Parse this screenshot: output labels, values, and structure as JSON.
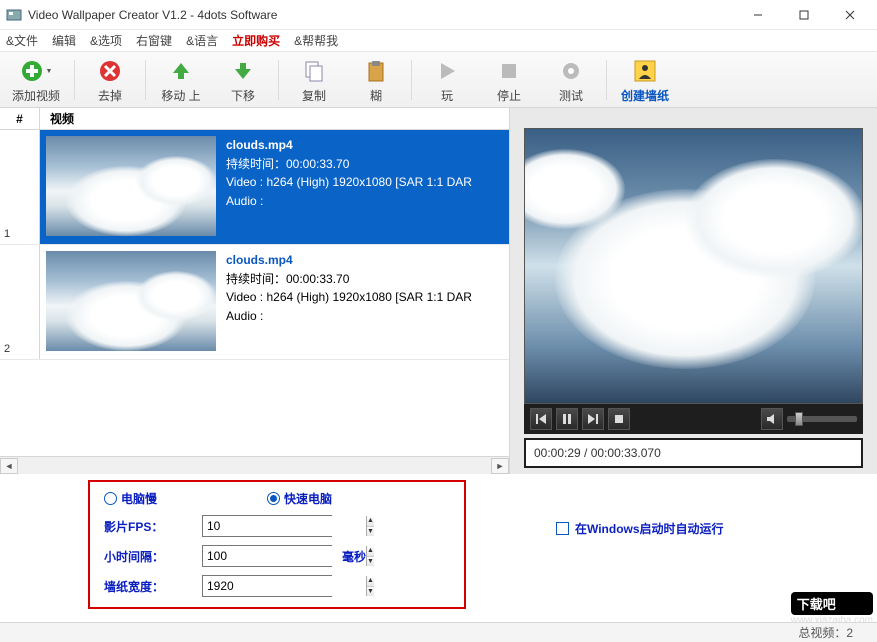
{
  "window": {
    "title": "Video Wallpaper Creator V1.2 - 4dots Software"
  },
  "menu": {
    "file": "&文件",
    "edit": "编辑",
    "options": "&选项",
    "right_key": "右窗键",
    "language": "&语言",
    "buy": "立即购买",
    "help": "&帮帮我"
  },
  "toolbar": {
    "add": "添加视频",
    "remove": "去掉",
    "move_up": "移动 上",
    "move_down": "下移",
    "copy": "复制",
    "paste": "糊",
    "play": "玩",
    "stop": "停止",
    "test": "测试",
    "create": "创建墙纸"
  },
  "list": {
    "col_num": "#",
    "col_video": "视频",
    "rows": [
      {
        "idx": "1",
        "name": "clouds.mp4",
        "duration": "持续时间：00:00:33.70",
        "video": "Video : h264 (High) 1920x1080 [SAR 1:1 DAR",
        "audio": "Audio :"
      },
      {
        "idx": "2",
        "name": "clouds.mp4",
        "duration": "持续时间：00:00:33.70",
        "video": "Video : h264 (High) 1920x1080 [SAR 1:1 DAR",
        "audio": "Audio :"
      }
    ]
  },
  "player": {
    "time": "00:00:29 / 00:00:33.070"
  },
  "settings": {
    "slow_pc": "电脑慢",
    "fast_pc": "快速电脑",
    "fps_label": "影片FPS：",
    "fps_value": "10",
    "interval_label": "小时间隔：",
    "interval_value": "100",
    "interval_unit": "毫秒",
    "width_label": "墙纸宽度：",
    "width_value": "1920",
    "autorun": "在Windows启动时自动运行"
  },
  "status": {
    "total": "总视频：2"
  },
  "watermark": {
    "brand": "下载吧",
    "url": "www.xiazaiba.com"
  }
}
